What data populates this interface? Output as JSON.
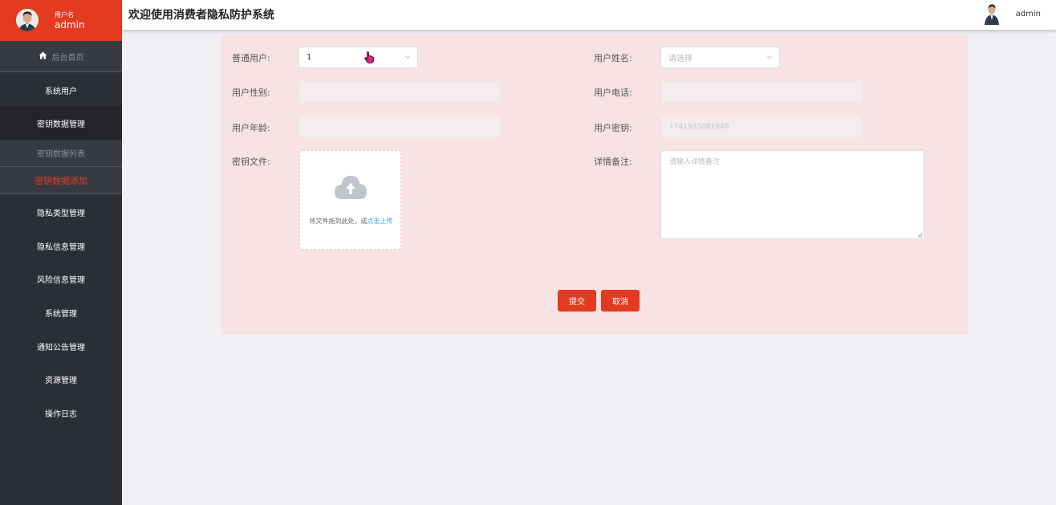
{
  "app": {
    "title": "欢迎使用消费者隐私防护系统"
  },
  "sidebar": {
    "user_label": "用户名",
    "user_name": "admin",
    "home_label": "后台首页",
    "items": [
      {
        "label": "系统用户"
      },
      {
        "label": "密钥数据管理"
      },
      {
        "label": "密钥数据列表"
      },
      {
        "label": "密钥数据添加"
      },
      {
        "label": "隐私类型管理"
      },
      {
        "label": "隐私信息管理"
      },
      {
        "label": "风险信息管理"
      },
      {
        "label": "系统管理"
      },
      {
        "label": "通知公告管理"
      },
      {
        "label": "资源管理"
      },
      {
        "label": "操作日志"
      }
    ],
    "active_color": "#e33a20",
    "accent_color": "#e33a20"
  },
  "header": {
    "user_name": "admin"
  },
  "form": {
    "normal_user_label": "普通用户:",
    "normal_user_value": "1",
    "user_name_label": "用户姓名:",
    "user_name_placeholder": "请选择",
    "gender_label": "用户性别:",
    "phone_label": "用户电话:",
    "age_label": "用户年龄:",
    "key_label": "用户密钥:",
    "key_value": "1741935081948",
    "key_file_label": "密钥文件:",
    "upload_hint": "将文件拖到此处，或",
    "upload_link": "点击上传",
    "details_label": "详情备注:",
    "details_placeholder": "请输入详情备注",
    "submit_label": "提交",
    "cancel_label": "取消"
  },
  "icons": [
    "avatar",
    "home-icon",
    "chevron-down-icon",
    "cloud-upload-icon",
    "hand-pointer-icon",
    "resize-handle-icon"
  ]
}
